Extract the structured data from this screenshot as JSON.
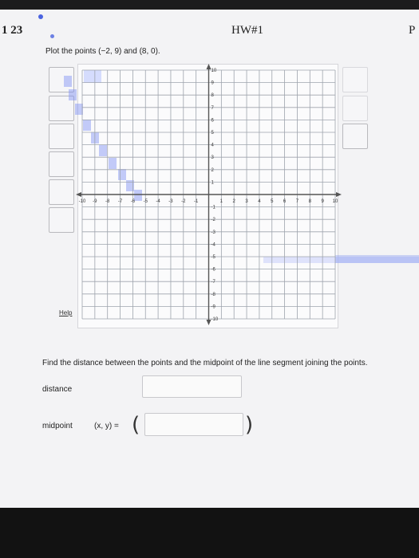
{
  "header": {
    "left_text": "1 23",
    "center_text": "HW#1",
    "right_text": "P"
  },
  "question": {
    "prompt": "Plot the points (−2, 9) and (8, 0).",
    "help_label": "Help"
  },
  "graph": {
    "x_ticks": [
      "-10",
      "-9",
      "-8",
      "-7",
      "-6",
      "-5",
      "-4",
      "-3",
      "-2",
      "-1",
      "1",
      "2",
      "3",
      "4",
      "5",
      "6",
      "7",
      "8",
      "9",
      "10"
    ],
    "y_ticks": [
      "10",
      "9",
      "8",
      "7",
      "6",
      "5",
      "4",
      "3",
      "2",
      "1",
      "-1",
      "-2",
      "-3",
      "-4",
      "-5",
      "-6",
      "-7",
      "-8",
      "-9",
      "-10"
    ],
    "x_range": [
      -10,
      10
    ],
    "y_range": [
      -10,
      10
    ],
    "axis_color": "#555555",
    "grid_color": "#9ea4ad"
  },
  "part2": {
    "instruction": "Find the distance between the points and the midpoint of the line segment joining the points.",
    "distance_label": "distance",
    "midpoint_label": "midpoint",
    "coord_label": "(x, y) =",
    "open_paren": "(",
    "close_paren": ")"
  },
  "icons": {
    "tool_buttons": "graph-tool-icon",
    "glare": "blue-light-glare"
  },
  "colors": {
    "accent": "#4a63e0",
    "page": "#f3f3f5"
  }
}
